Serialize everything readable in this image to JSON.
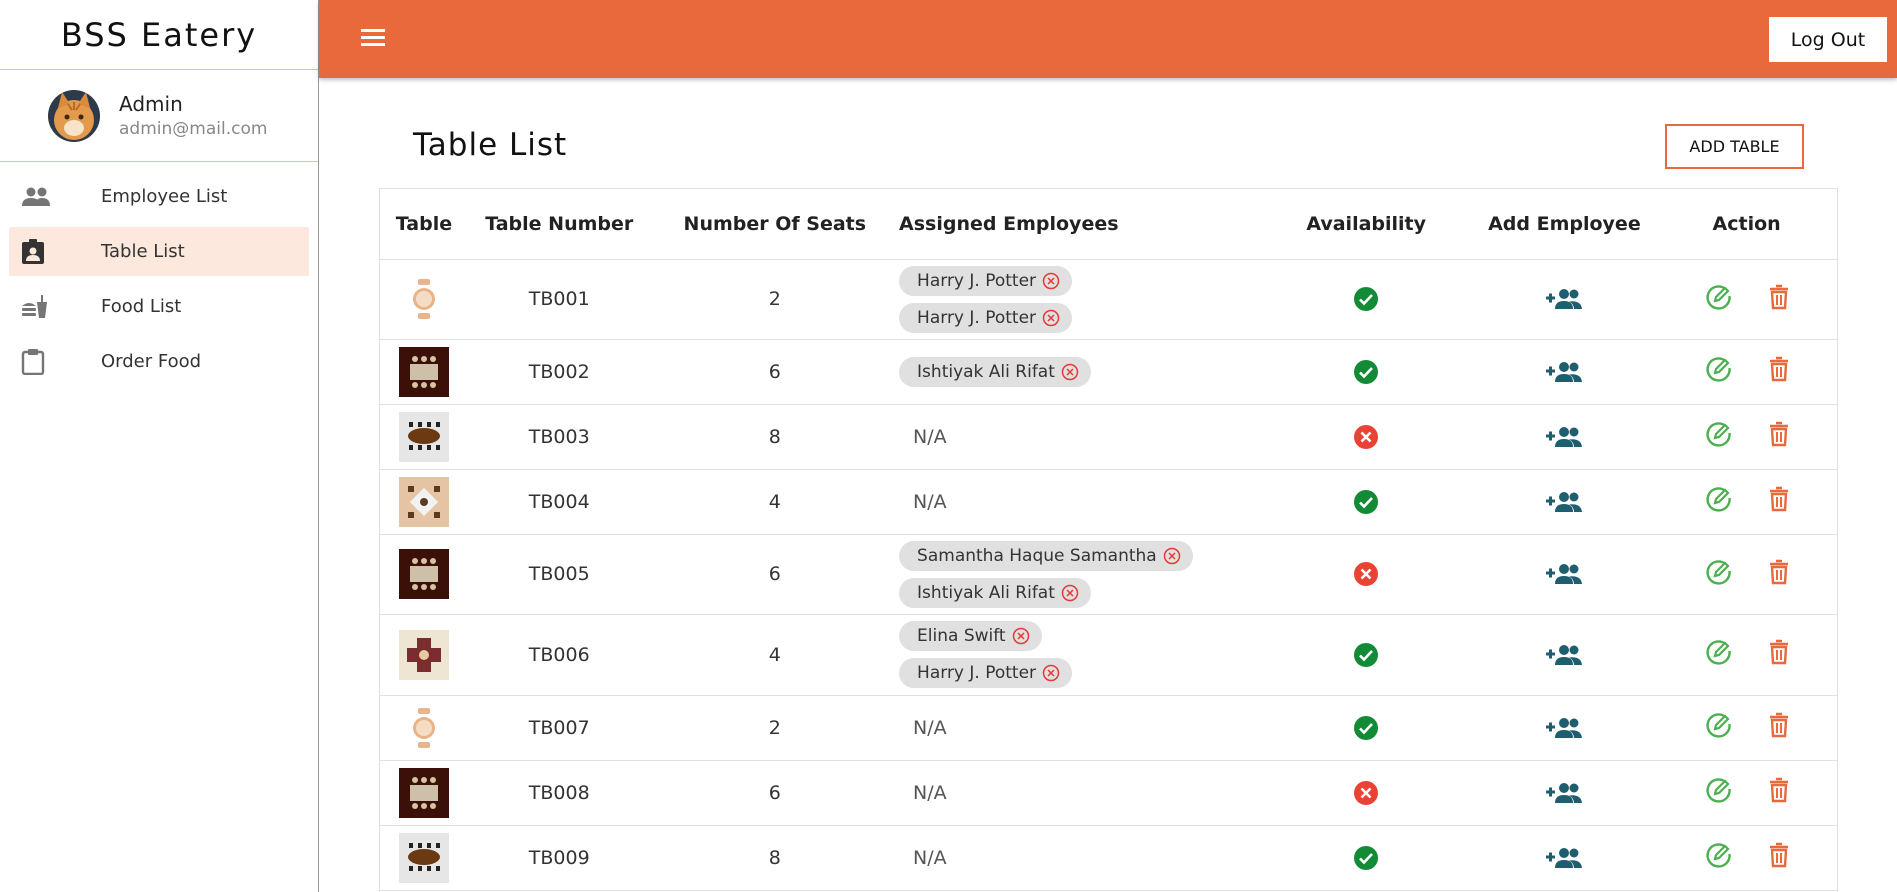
{
  "app": {
    "brand": "BSS Eatery"
  },
  "profile": {
    "name": "Admin",
    "email": "admin@mail.com"
  },
  "sidebar": {
    "items": [
      {
        "label": "Employee List",
        "icon": "people-icon",
        "active": false
      },
      {
        "label": "Table List",
        "icon": "badge-icon",
        "active": true
      },
      {
        "label": "Food List",
        "icon": "fastfood-icon",
        "active": false
      },
      {
        "label": "Order Food",
        "icon": "clipboard-icon",
        "active": false
      }
    ]
  },
  "header": {
    "logout_label": "Log Out"
  },
  "main": {
    "title": "Table List",
    "add_button_label": "ADD TABLE",
    "columns": [
      "Table",
      "Table Number",
      "Number Of Seats",
      "Assigned Employees",
      "Availability",
      "Add Employee",
      "Action"
    ],
    "na_label": "N/A",
    "rows": [
      {
        "number": "TB001",
        "seats": "2",
        "thumb": "round2",
        "employees": [
          "Harry J. Potter",
          "Harry J. Potter"
        ],
        "available": true
      },
      {
        "number": "TB002",
        "seats": "6",
        "thumb": "dark6",
        "employees": [
          "Ishtiyak Ali Rifat"
        ],
        "available": true
      },
      {
        "number": "TB003",
        "seats": "8",
        "thumb": "oval8",
        "employees": [],
        "available": false
      },
      {
        "number": "TB004",
        "seats": "4",
        "thumb": "square4",
        "employees": [],
        "available": true
      },
      {
        "number": "TB005",
        "seats": "6",
        "thumb": "dark6",
        "employees": [
          "Samantha Haque Samantha",
          "Ishtiyak Ali Rifat"
        ],
        "available": false
      },
      {
        "number": "TB006",
        "seats": "4",
        "thumb": "cross4",
        "employees": [
          "Elina Swift",
          "Harry J. Potter"
        ],
        "available": true
      },
      {
        "number": "TB007",
        "seats": "2",
        "thumb": "round2",
        "employees": [],
        "available": true
      },
      {
        "number": "TB008",
        "seats": "6",
        "thumb": "dark6",
        "employees": [],
        "available": false
      },
      {
        "number": "TB009",
        "seats": "8",
        "thumb": "oval8",
        "employees": [],
        "available": true
      }
    ]
  },
  "colors": {
    "accent": "#e8693c",
    "active_nav_bg": "#fde8de",
    "available": "#138a36",
    "unavailable": "#ea4335",
    "add_employee_icon": "#1f5e6e",
    "edit_icon": "#4caf50",
    "delete_icon": "#e8693c"
  }
}
